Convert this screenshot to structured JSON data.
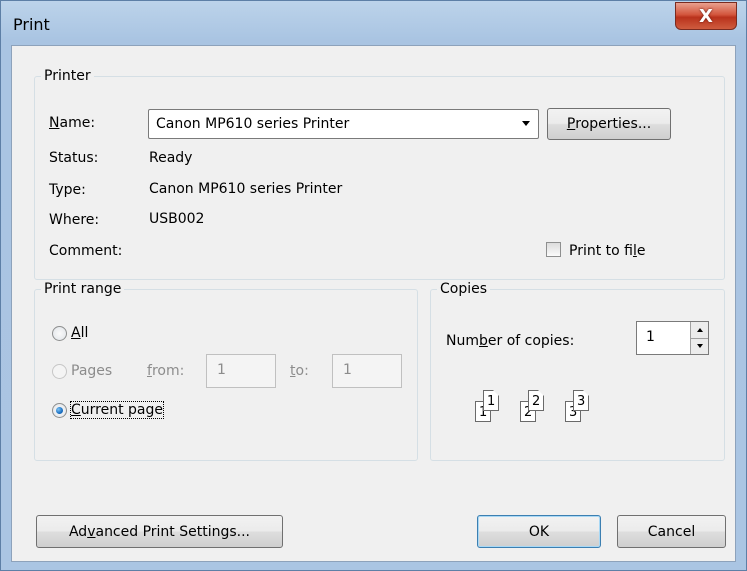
{
  "window": {
    "title": "Print",
    "close_label": "X"
  },
  "printer": {
    "group_label": "Printer",
    "name_label": "Name:",
    "name_mnemonic": "N",
    "name_rest": "ame:",
    "name_value": "Canon MP610 series Printer",
    "properties_label": "Properties...",
    "properties_mnemonic": "P",
    "properties_rest": "roperties...",
    "status_label": "Status:",
    "status_value": "Ready",
    "type_label": "Type:",
    "type_value": "Canon MP610 series Printer",
    "where_label": "Where:",
    "where_value": "USB002",
    "comment_label": "Comment:",
    "print_to_file_pre": "Print to fi",
    "print_to_file_mnemonic": "l",
    "print_to_file_post": "e",
    "print_to_file_checked": false
  },
  "print_range": {
    "group_label": "Print range",
    "all_mnemonic": "A",
    "all_rest": "ll",
    "pages_label": "Pages",
    "from_mnemonic": "f",
    "from_rest": "rom:",
    "from_value": "1",
    "to_mnemonic": "t",
    "to_rest": "o:",
    "to_value": "1",
    "current_mnemonic": "C",
    "current_rest": "urrent page",
    "selected": "Current page"
  },
  "copies": {
    "group_label": "Copies",
    "number_pre": "Num",
    "number_mnemonic": "b",
    "number_post": "er of copies:",
    "number_value": "1",
    "collate_pages": [
      "1",
      "1",
      "2",
      "2",
      "3",
      "3"
    ]
  },
  "footer": {
    "advanced_pre": "Ad",
    "advanced_mnemonic": "v",
    "advanced_post": "anced Print Settings...",
    "ok_label": "OK",
    "cancel_label": "Cancel"
  },
  "colors": {
    "close_button": "#c94a31",
    "dialog_bg": "#f0f0f0",
    "radio_selected": "#1a6fc2",
    "default_button_border": "#3c7fb1"
  }
}
